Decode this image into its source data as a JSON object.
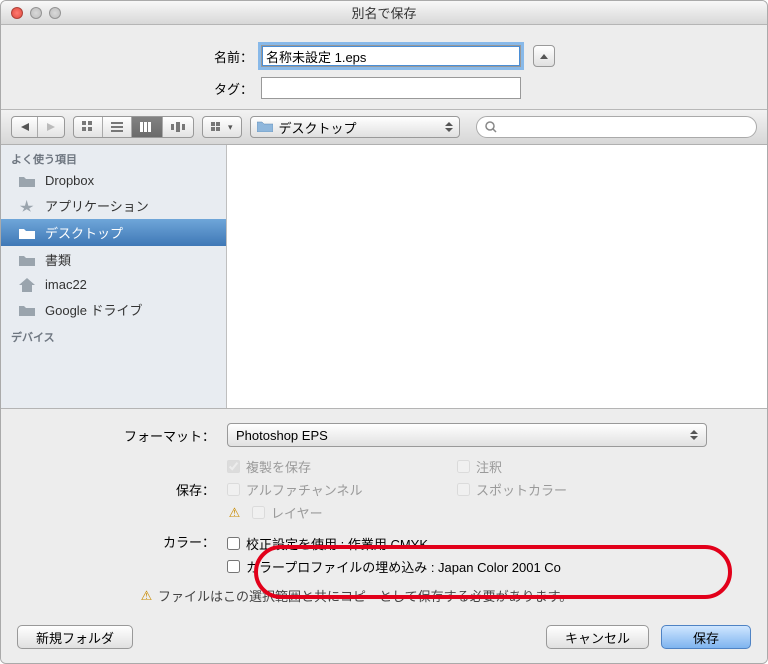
{
  "window": {
    "title": "別名で保存"
  },
  "fields": {
    "name_label": "名前：",
    "name_value": "名称未設定 1.eps",
    "tag_label": "タグ：",
    "tag_value": ""
  },
  "toolbar": {
    "location": "デスクトップ",
    "search_placeholder": ""
  },
  "sidebar": {
    "favorites_header": "よく使う項目",
    "devices_header": "デバイス",
    "items": [
      {
        "label": "Dropbox",
        "icon": "folder",
        "selected": false
      },
      {
        "label": "アプリケーション",
        "icon": "apps",
        "selected": false
      },
      {
        "label": "デスクトップ",
        "icon": "folder",
        "selected": true
      },
      {
        "label": "書類",
        "icon": "folder",
        "selected": false
      },
      {
        "label": "imac22",
        "icon": "home",
        "selected": false
      },
      {
        "label": "Google ドライブ",
        "icon": "folder",
        "selected": false
      }
    ]
  },
  "options": {
    "format_label": "フォーマット：",
    "format_value": "Photoshop EPS",
    "save_label": "保存：",
    "copy_checkbox": "複製を保存",
    "annotation_checkbox": "注釈",
    "alpha_checkbox": "アルファチャンネル",
    "spot_checkbox": "スポットカラー",
    "layers_checkbox": "レイヤー",
    "color_label": "カラー：",
    "proof_checkbox": "校正設定を使用 : 作業用 CMYK",
    "embed_checkbox": "カラープロファイルの埋め込み : Japan Color 2001 Co",
    "note": "ファイルはこの選択範囲と共にコピーとして保存する必要があります。"
  },
  "footer": {
    "new_folder": "新規フォルダ",
    "cancel": "キャンセル",
    "save": "保存"
  }
}
